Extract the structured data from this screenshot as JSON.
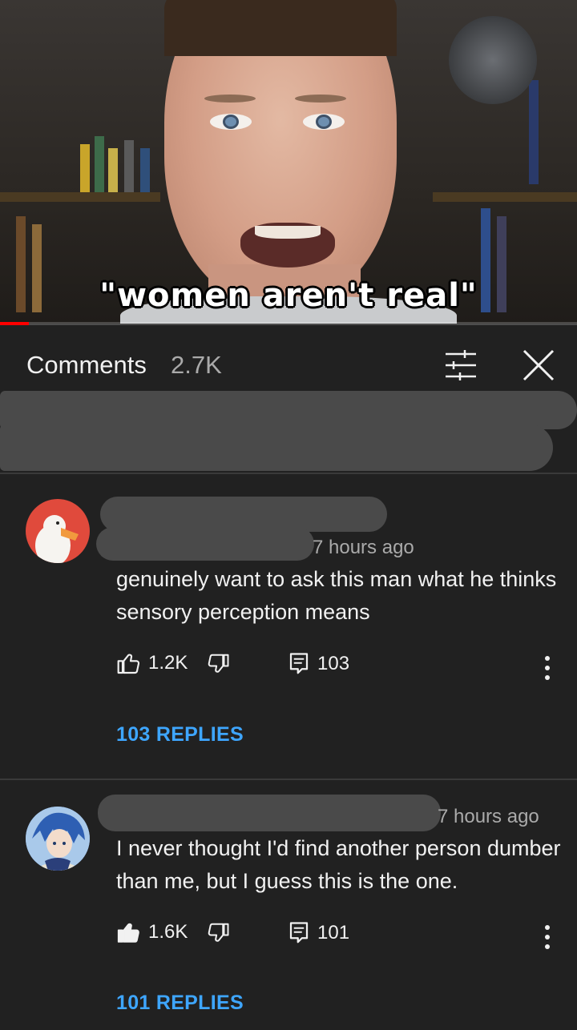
{
  "video": {
    "caption": "\"women aren't real\"",
    "progress_fraction": 0.05
  },
  "header": {
    "title": "Comments",
    "count": "2.7K"
  },
  "comments": [
    {
      "timestamp": "7 hours ago",
      "text": "genuinely want to ask this man what he thinks sensory perception means",
      "likes": "1.2K",
      "liked": false,
      "reply_count": "103",
      "replies_link": "103 REPLIES",
      "avatar": "duck-avatar"
    },
    {
      "timestamp": "7 hours ago",
      "text": "I never thought I'd find another person dumber than me, but I guess this is the one.",
      "likes": "1.6K",
      "liked": true,
      "reply_count": "101",
      "replies_link": "101 REPLIES",
      "avatar": "anime-character-avatar"
    }
  ],
  "colors": {
    "background": "#212121",
    "accent_link": "#3ea6ff",
    "progress": "#ff0000",
    "secondary_text": "#aaaaaa"
  }
}
